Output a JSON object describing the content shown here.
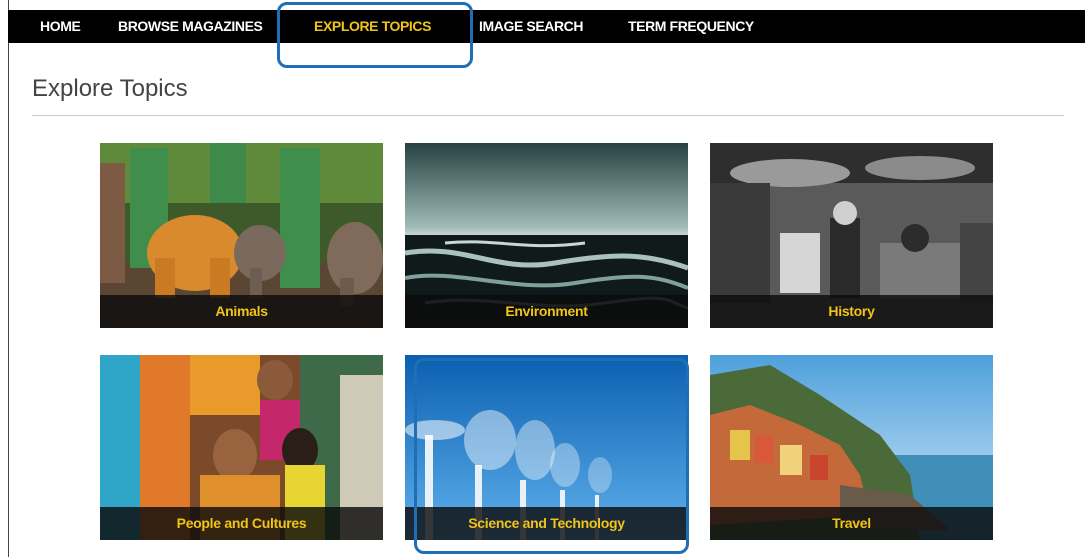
{
  "nav": {
    "items": [
      {
        "label": "HOME"
      },
      {
        "label": "BROWSE MAGAZINES"
      },
      {
        "label": "EXPLORE TOPICS"
      },
      {
        "label": "IMAGE SEARCH"
      },
      {
        "label": "TERM FREQUENCY"
      }
    ],
    "active": "EXPLORE TOPICS"
  },
  "page": {
    "title": "Explore Topics"
  },
  "topics": [
    {
      "label": "Animals",
      "image": "animals-photo"
    },
    {
      "label": "Environment",
      "image": "environment-photo"
    },
    {
      "label": "History",
      "image": "history-photo"
    },
    {
      "label": "People and Cultures",
      "image": "people-photo"
    },
    {
      "label": "Science and Technology",
      "image": "science-photo"
    },
    {
      "label": "Travel",
      "image": "travel-photo"
    }
  ],
  "colors": {
    "nav_background": "#000000",
    "nav_text": "#ffffff",
    "accent": "#f0c419",
    "callout": "#1e6fb6"
  }
}
